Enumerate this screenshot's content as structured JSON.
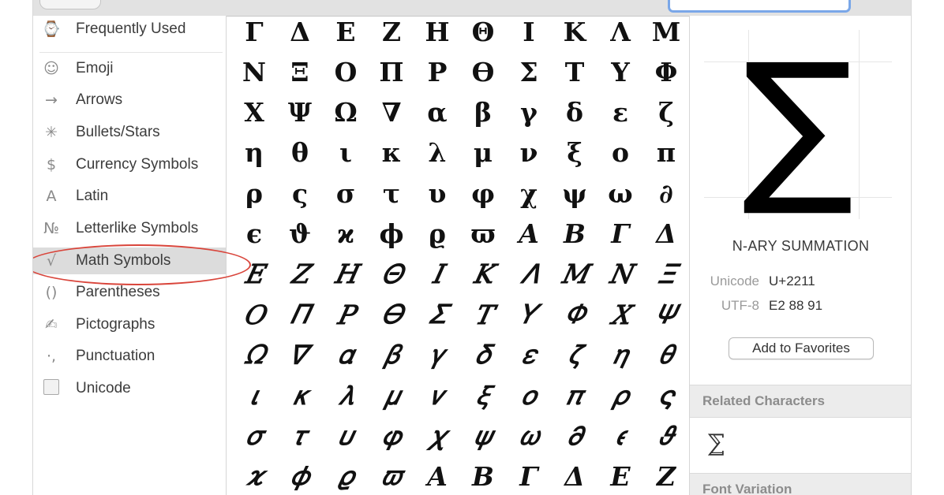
{
  "sidebar": {
    "items": [
      {
        "label": "Frequently Used",
        "icon": "⌚",
        "icon_name": "clock-icon"
      },
      {
        "label": "Emoji",
        "icon": "☺",
        "icon_name": "smiley-icon"
      },
      {
        "label": "Arrows",
        "icon": "→",
        "icon_name": "arrow-icon"
      },
      {
        "label": "Bullets/Stars",
        "icon": "✳",
        "icon_name": "asterisk-icon"
      },
      {
        "label": "Currency Symbols",
        "icon": "$",
        "icon_name": "dollar-icon"
      },
      {
        "label": "Latin",
        "icon": "A",
        "icon_name": "latin-a-icon"
      },
      {
        "label": "Letterlike Symbols",
        "icon": "№",
        "icon_name": "numero-icon"
      },
      {
        "label": "Math Symbols",
        "icon": "√",
        "icon_name": "square-root-icon",
        "selected": true
      },
      {
        "label": "Parentheses",
        "icon": "()",
        "icon_name": "parentheses-icon"
      },
      {
        "label": "Pictographs",
        "icon": "✍",
        "icon_name": "pictograph-icon"
      },
      {
        "label": "Punctuation",
        "icon": "·,",
        "icon_name": "punctuation-icon"
      },
      {
        "label": "Unicode",
        "icon": "",
        "icon_name": "unicode-box-icon"
      }
    ]
  },
  "grid": {
    "rows": [
      [
        "Γ",
        "Δ",
        "Ε",
        "Ζ",
        "Η",
        "Θ",
        "Ι",
        "Κ",
        "Λ",
        "Μ"
      ],
      [
        "Ν",
        "Ξ",
        "Ο",
        "Π",
        "Ρ",
        "ϴ",
        "Σ",
        "Τ",
        "Υ",
        "Φ"
      ],
      [
        "Χ",
        "Ψ",
        "Ω",
        "∇",
        "α",
        "β",
        "γ",
        "δ",
        "ε",
        "ζ"
      ],
      [
        "η",
        "θ",
        "ι",
        "κ",
        "λ",
        "μ",
        "ν",
        "ξ",
        "ο",
        "π"
      ],
      [
        "ρ",
        "ς",
        "σ",
        "τ",
        "υ",
        "φ",
        "χ",
        "ψ",
        "ω",
        "∂"
      ],
      [
        "ϵ",
        "ϑ",
        "ϰ",
        "ϕ",
        "ϱ",
        "ϖ",
        "𝑨",
        "𝑩",
        "𝜞",
        "𝜟"
      ],
      [
        "𝐸",
        "𝑍",
        "𝐻",
        "𝛩",
        "𝐼",
        "𝐾",
        "𝛬",
        "𝑀",
        "𝑁",
        "𝛯"
      ],
      [
        "𝑂",
        "𝛱",
        "𝑃",
        "𝛳",
        "𝛴",
        "𝑇",
        "𝛶",
        "𝛷",
        "𝑋",
        "𝛹"
      ],
      [
        "𝛺",
        "𝛻",
        "𝛼",
        "𝛽",
        "𝛾",
        "𝛿",
        "𝜀",
        "𝜁",
        "𝜂",
        "𝜃"
      ],
      [
        "𝜄",
        "𝜅",
        "𝜆",
        "𝜇",
        "𝜈",
        "𝜉",
        "𝜊",
        "𝜋",
        "𝜌",
        "𝜍"
      ],
      [
        "𝜎",
        "𝜏",
        "𝜐",
        "𝜑",
        "𝜒",
        "𝜓",
        "𝜔",
        "𝜕",
        "𝜖",
        "𝜗"
      ],
      [
        "𝜘",
        "𝜙",
        "𝜚",
        "𝜛",
        "𝜜",
        "𝜝",
        "𝜞",
        "𝜟",
        "𝜠",
        "𝜡"
      ]
    ]
  },
  "preview": {
    "glyph": "∑",
    "name": "N-ARY SUMMATION",
    "unicode_label": "Unicode",
    "unicode_value": "U+2211",
    "utf8_label": "UTF-8",
    "utf8_value": "E2 88 91",
    "favorites_button": "Add to Favorites",
    "related_heading": "Related Characters",
    "related_glyph": "⅀",
    "font_variation_heading": "Font Variation"
  },
  "colors": {
    "selection_bg": "#dcdcdc",
    "highlight_ring": "#d9453b",
    "search_focus": "#7aa7e8"
  }
}
